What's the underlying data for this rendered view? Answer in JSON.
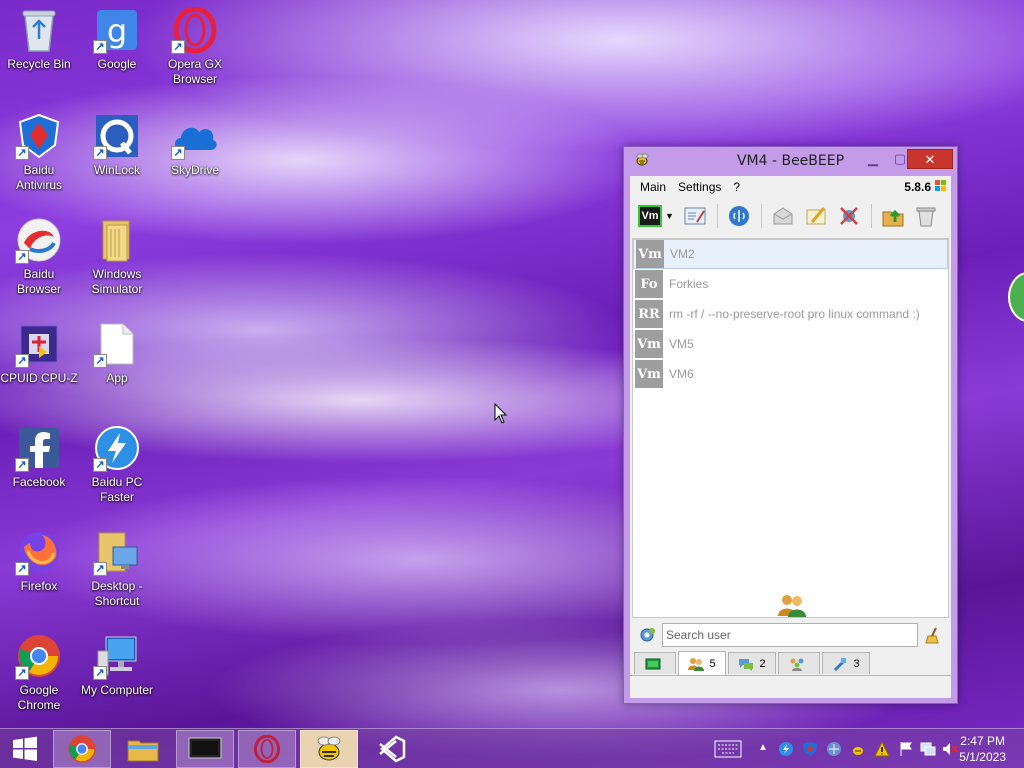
{
  "desktop": {
    "icons": [
      {
        "label": "Recycle Bin",
        "icon": "recycle-bin-icon"
      },
      {
        "label": "Google",
        "icon": "google-icon"
      },
      {
        "label": "Opera GX Browser",
        "icon": "opera-gx-icon"
      },
      {
        "label": "Baidu Antivirus",
        "icon": "baidu-antivirus-icon"
      },
      {
        "label": "WinLock",
        "icon": "winlock-icon"
      },
      {
        "label": "SkyDrive",
        "icon": "skydrive-icon"
      },
      {
        "label": "Baidu Browser",
        "icon": "baidu-browser-icon"
      },
      {
        "label": "Windows Simulator",
        "icon": "folder-icon"
      },
      {
        "label": "CPUID CPU-Z",
        "icon": "cpu-z-icon"
      },
      {
        "label": "App",
        "icon": "blank-file-icon"
      },
      {
        "label": "Facebook",
        "icon": "facebook-icon"
      },
      {
        "label": "Baidu PC Faster",
        "icon": "baidu-pc-faster-icon"
      },
      {
        "label": "Firefox",
        "icon": "firefox-icon"
      },
      {
        "label": "Desktop - Shortcut",
        "icon": "desktop-folder-icon"
      },
      {
        "label": "Google Chrome",
        "icon": "chrome-icon"
      },
      {
        "label": "My Computer",
        "icon": "my-computer-icon"
      }
    ]
  },
  "window": {
    "title": "VM4 - BeeBEEP",
    "close_glyph": "✕",
    "min_glyph": "▁",
    "max_glyph": "▢",
    "menu": [
      "Main",
      "Settings",
      "?"
    ],
    "version": "5.8.6",
    "status_badge": "Vm",
    "users": [
      {
        "initials": "Vm",
        "name": "VM2",
        "selected": true
      },
      {
        "initials": "Fo",
        "name": "Forkies",
        "selected": false
      },
      {
        "initials": "RR",
        "name": "rm -rf / --no-preserve-root pro linux command :)",
        "selected": false
      },
      {
        "initials": "Vm",
        "name": "VM5",
        "selected": false
      },
      {
        "initials": "Vm",
        "name": "VM6",
        "selected": false
      }
    ],
    "search_placeholder": "Search user",
    "tabs": [
      {
        "icon": "home-icon",
        "count": ""
      },
      {
        "icon": "users-icon",
        "count": "5"
      },
      {
        "icon": "chats-icon",
        "count": "2"
      },
      {
        "icon": "groups-icon",
        "count": ""
      },
      {
        "icon": "shares-icon",
        "count": "3"
      }
    ]
  },
  "taskbar": {
    "clock_time": "2:47 PM",
    "clock_date": "5/1/2023"
  }
}
